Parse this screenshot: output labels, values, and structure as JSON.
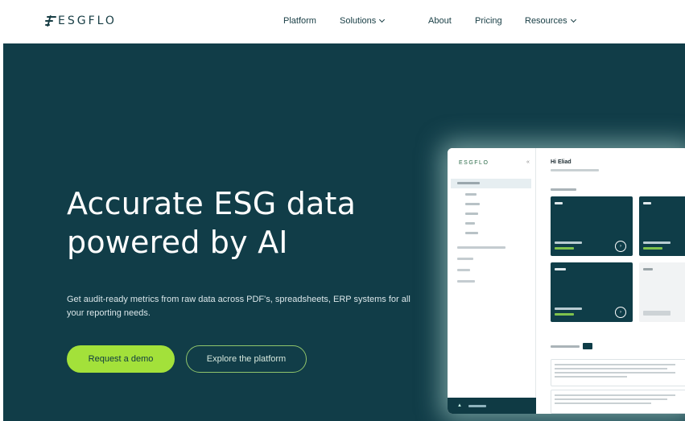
{
  "brand": {
    "name": "ESGFLO",
    "accent": "#a3e13a",
    "dark": "#113d48"
  },
  "nav": {
    "items": [
      {
        "label": "Platform",
        "dropdown": false
      },
      {
        "label": "Solutions",
        "dropdown": true
      },
      {
        "label": "About",
        "dropdown": false
      },
      {
        "label": "Pricing",
        "dropdown": false
      },
      {
        "label": "Resources",
        "dropdown": true
      }
    ]
  },
  "hero": {
    "title_line1": "Accurate ESG data",
    "title_line2": "powered by AI",
    "subtitle": "Get audit-ready metrics from raw data across PDF's, spreadsheets, ERP systems for all your reporting needs.",
    "cta_primary": "Request a demo",
    "cta_secondary": "Explore the platform"
  },
  "mockup": {
    "logo": "ESGFLO",
    "greeting": "Hi Eliad"
  }
}
